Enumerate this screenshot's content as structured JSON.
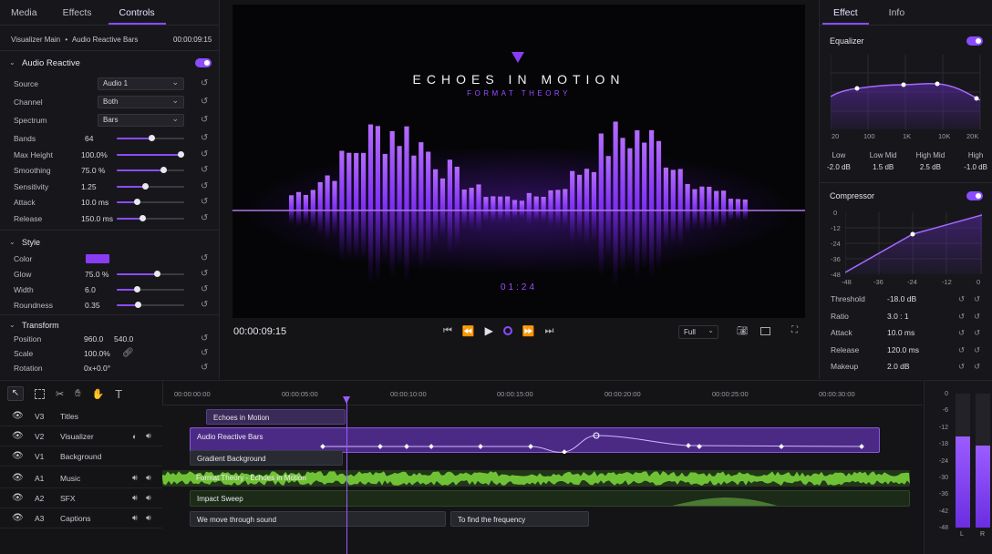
{
  "left_tabs": [
    "Media",
    "Effects",
    "Controls"
  ],
  "breadcrumb": {
    "a": "Visualizer Main",
    "b": "Audio Reactive Bars",
    "time": "00:00:09:15"
  },
  "audio_reactive": {
    "title": "Audio Reactive",
    "source": {
      "label": "Source",
      "value": "Audio 1"
    },
    "channel": {
      "label": "Channel",
      "value": "Both"
    },
    "spectrum": {
      "label": "Spectrum",
      "value": "Bars"
    },
    "bands": {
      "label": "Bands",
      "value": "64",
      "level": 0.52
    },
    "max_height": {
      "label": "Max Height",
      "value": "100.0%",
      "level": 0.95
    },
    "smoothing": {
      "label": "Smoothing",
      "value": "75.0 %",
      "level": 0.7
    },
    "sensitivity": {
      "label": "Sensitivity",
      "value": "1.25",
      "level": 0.42
    },
    "attack": {
      "label": "Attack",
      "value": "10.0 ms",
      "level": 0.3
    },
    "release": {
      "label": "Release",
      "value": "150.0 ms",
      "level": 0.38
    }
  },
  "style": {
    "title": "Style",
    "color": {
      "label": "Color",
      "swatch": "#8a3cf5"
    },
    "glow": {
      "label": "Glow",
      "value": "75.0 %",
      "level": 0.6
    },
    "width": {
      "label": "Width",
      "value": "6.0",
      "level": 0.3
    },
    "roundness": {
      "label": "Roundness",
      "value": "0.35",
      "level": 0.32
    }
  },
  "transform": {
    "title": "Transform",
    "position": {
      "label": "Position",
      "x": "960.0",
      "y": "540.0"
    },
    "scale": {
      "label": "Scale",
      "value": "100.0%"
    },
    "rotation": {
      "label": "Rotation",
      "value": "0x+0.0°"
    }
  },
  "preview": {
    "title": "ECHOES IN MOTION",
    "subtitle": "FORMAT THEORY",
    "time_overlay": "01:24",
    "timecode": "00:00:09:15",
    "zoom": "Full"
  },
  "right_tabs": [
    "Effect",
    "Info"
  ],
  "equalizer": {
    "title": "Equalizer",
    "freq_ticks": [
      "20",
      "100",
      "1K",
      "10K",
      "20K"
    ],
    "bands": [
      {
        "name": "Low",
        "gain": "-2.0 dB"
      },
      {
        "name": "Low Mid",
        "gain": "1.5 dB"
      },
      {
        "name": "High Mid",
        "gain": "2.5 dB"
      },
      {
        "name": "High",
        "gain": "-1.0 dB"
      }
    ]
  },
  "compressor": {
    "title": "Compressor",
    "y_ticks": [
      "0",
      "-12",
      "-24",
      "-36",
      "-48"
    ],
    "x_ticks": [
      "-48",
      "-36",
      "-24",
      "-12",
      "0"
    ],
    "params": [
      {
        "name": "Threshold",
        "value": "-18.0 dB"
      },
      {
        "name": "Ratio",
        "value": "3.0 : 1"
      },
      {
        "name": "Attack",
        "value": "10.0 ms"
      },
      {
        "name": "Release",
        "value": "120.0 ms"
      },
      {
        "name": "Makeup",
        "value": "2.0 dB"
      }
    ]
  },
  "timeline": {
    "ruler": [
      "00:00:00:00",
      "00:00:05:00",
      "00:00:10:00",
      "00:00:15:00",
      "00:00:20:00",
      "00:00:25:00",
      "00:00:30:00"
    ],
    "tracks": [
      {
        "id": "V3",
        "name": "Titles"
      },
      {
        "id": "V2",
        "name": "Visualizer"
      },
      {
        "id": "V1",
        "name": "Background"
      },
      {
        "id": "A1",
        "name": "Music"
      },
      {
        "id": "A2",
        "name": "SFX"
      },
      {
        "id": "A3",
        "name": "Captions"
      }
    ],
    "clips": {
      "titles": "Echoes in Motion",
      "visualizer": "Audio Reactive Bars",
      "background": "Gradient Background",
      "music": "Format Theory - Echoes in Motion",
      "sfx": "Impact Sweep",
      "caption1": "We move through sound",
      "caption2": "To find the frequency"
    }
  },
  "meter": {
    "ticks": [
      "0",
      "-6",
      "-12",
      "-18",
      "-24",
      "-30",
      "-36",
      "-42",
      "-48"
    ],
    "L": "L",
    "R": "R",
    "left_level": 0.68,
    "right_level": 0.61
  }
}
